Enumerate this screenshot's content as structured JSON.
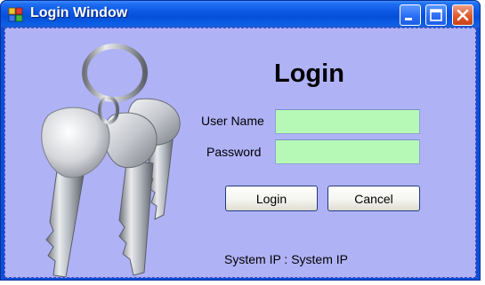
{
  "window": {
    "title": "Login Window",
    "icons": [
      "app-icon",
      "minimize-icon",
      "maximize-icon",
      "close-icon"
    ]
  },
  "form": {
    "heading": "Login",
    "username_label": "User Name",
    "username_value": "",
    "password_label": "Password",
    "password_value": "",
    "login_button": "Login",
    "cancel_button": "Cancel",
    "system_ip": "System IP : System IP"
  },
  "colors": {
    "client_background": "#b0b2f6",
    "input_background": "#b6f9b6",
    "titlebar": "#0a55e3"
  }
}
